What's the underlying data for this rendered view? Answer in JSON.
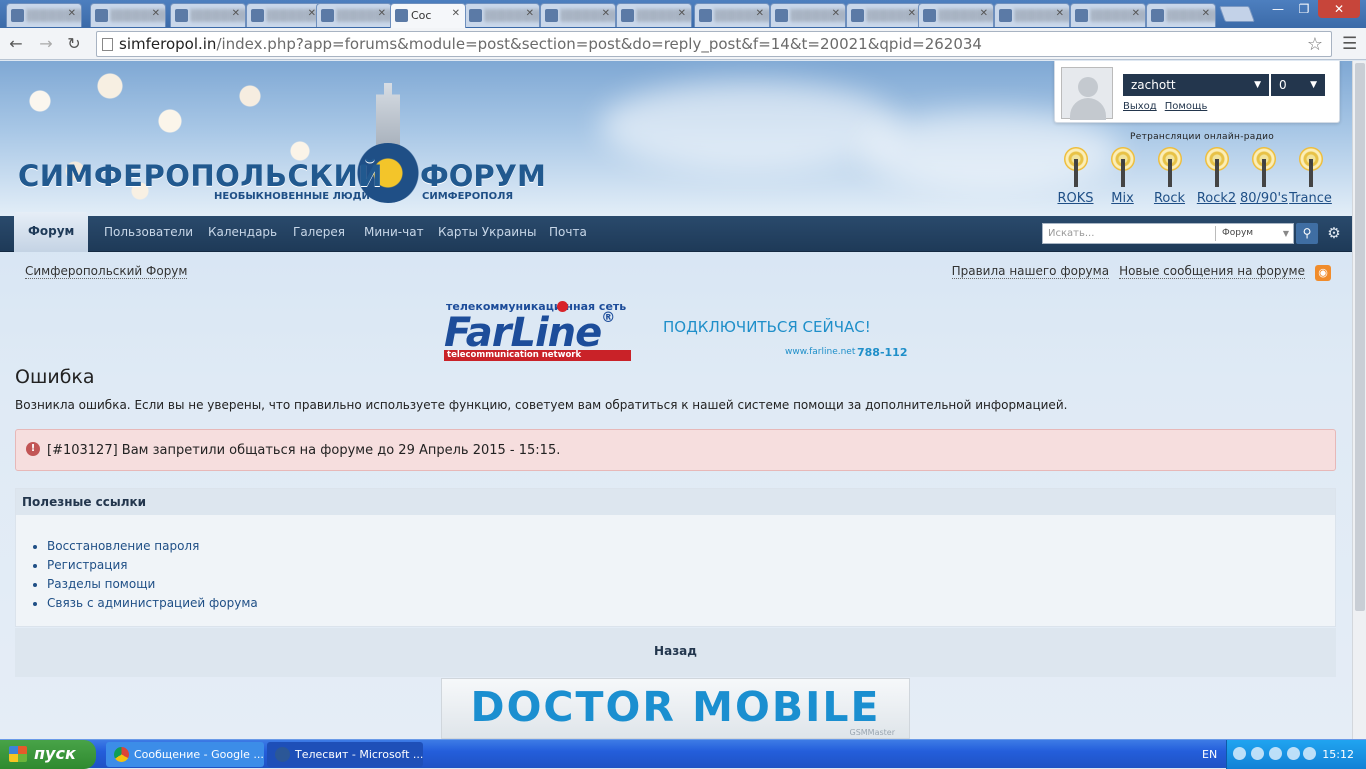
{
  "browser": {
    "tabs": [
      {
        "title": "░░░░░░░░",
        "blurred": true
      },
      {
        "title": "░░░░░░░░",
        "blurred": true
      },
      {
        "title": "░░░░░░░░",
        "blurred": true
      },
      {
        "title": "░░░░░░░░",
        "blurred": true
      },
      {
        "title": "░░░░░░░░",
        "blurred": true
      },
      {
        "title": "Сос",
        "blurred": false,
        "active": true
      },
      {
        "title": "░░░░░░░░",
        "blurred": true
      },
      {
        "title": "░░░░░░░░",
        "blurred": true
      },
      {
        "title": "░░░░░░░░",
        "blurred": true
      },
      {
        "title": "░░░░░░░░",
        "blurred": true
      },
      {
        "title": "░░░░░░░░",
        "blurred": true
      },
      {
        "title": "░░░░░░░░",
        "blurred": true
      },
      {
        "title": "░░░░░░░░",
        "blurred": true
      },
      {
        "title": "░░░░░░░░",
        "blurred": true
      },
      {
        "title": "░░░░░░░░",
        "blurred": true
      },
      {
        "title": "░░░░░░░░",
        "blurred": true
      }
    ],
    "url_host": "simferopol.in",
    "url_path": "/index.php?app=forums&module=post&section=post&do=reply_post&f=14&t=20021&qpid=262034"
  },
  "site": {
    "logo_left": "СИМФЕРОПОЛЬСКИЙ",
    "logo_right": "ФОРУМ",
    "tagline_left": "НЕОБЫКНОВЕННЫЕ ЛЮДИ",
    "tagline_right": "СИМФЕРОПОЛЯ"
  },
  "user": {
    "name": "zachott",
    "count": "0",
    "logout": "Выход",
    "help": "Помощь"
  },
  "radio": {
    "title": "Ретрансляции онлайн-радио",
    "stations": [
      "ROKS",
      "Mix",
      "Rock",
      "Rock2",
      "80/90's",
      "Trance"
    ]
  },
  "nav": {
    "items": [
      "Форум",
      "Пользователи",
      "Календарь",
      "Галерея",
      "Мини-чат",
      "Карты Украины",
      "Почта"
    ],
    "search_placeholder": "Искать...",
    "search_scope": "Форум"
  },
  "content": {
    "breadcrumb": "Симферопольский Форум",
    "rules_link": "Правила нашего форума",
    "new_posts_link": "Новые сообщения на форуме",
    "title": "Ошибка",
    "description": "Возникла ошибка. Если вы не уверены, что правильно используете функцию, советуем вам обратиться к нашей системе помощи за дополнительной информацией.",
    "error_message": "[#103127] Вам запретили общаться на форуме до 29 Апрель 2015 - 15:15.",
    "useful_links_title": "Полезные ссылки",
    "useful_links": [
      "Восстановление пароля",
      "Регистрация",
      "Разделы помощи",
      "Связь с администрацией форума"
    ],
    "back": "Назад"
  },
  "ads": {
    "farline_top": "телекоммуникаци  нная сеть",
    "farline_brand": "FarLine",
    "farline_reg": "®",
    "farline_sub": "telecommunication network",
    "farline_cta": "ПОДКЛЮЧИТЬСЯ СЕЙЧАС!",
    "farline_site": "www.farline.net",
    "farline_phone": "788-112",
    "doctor": "DOCTOR MOBILE",
    "doctor_sub": "GSMMaster"
  },
  "taskbar": {
    "start": "пуск",
    "tasks": [
      "Сообщение - Google ...",
      "Телесвит - Microsoft ..."
    ],
    "lang": "EN",
    "clock": "15:12"
  },
  "colors": {
    "nav_bg": "#1e3a58",
    "link": "#1f4f86",
    "error_bg": "#f6dede",
    "taskbar": "#245edb"
  }
}
